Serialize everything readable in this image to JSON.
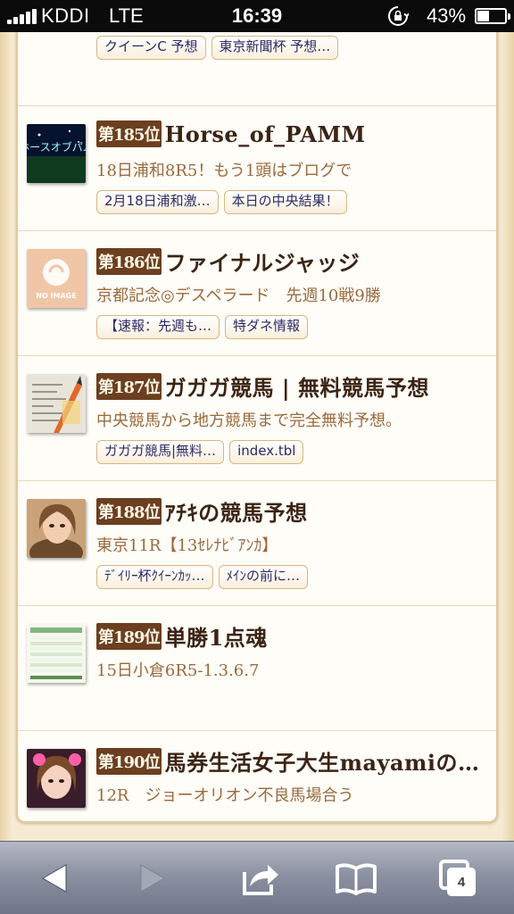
{
  "status_bar": {
    "carrier": "KDDI",
    "network": "LTE",
    "time": "16:39",
    "battery_percent": "43%",
    "battery_level": 0.43
  },
  "top_tags": [
    "クイーンC 予想",
    "東京新聞杯 予想…"
  ],
  "entries": [
    {
      "rank": "第185位",
      "title": "Horse_of_PAMM",
      "desc": "18日浦和8R5！もう1頭はブログで",
      "tags": [
        "2月18日浦和激…",
        "本日の中央結果！"
      ],
      "thumb": "night-banner-thumbnail",
      "thumb_text": "ホースオブパム"
    },
    {
      "rank": "第186位",
      "title": "ファイナルジャッジ",
      "desc": "京都記念◎デスペラード　先週10戦9勝",
      "tags": [
        "【速報：先週も…",
        "特ダネ情報"
      ],
      "thumb": "no-image-thumbnail",
      "thumb_text": "NO IMAGE"
    },
    {
      "rank": "第187位",
      "title": "ガガガ競馬 | 無料競馬予想",
      "desc": "中央競馬から地方競馬まで完全無料予想。",
      "tags": [
        "ガガガ競馬|無料…",
        "index.tbl"
      ],
      "thumb": "newspaper-pencil-thumbnail"
    },
    {
      "rank": "第188位",
      "title": "ｱﾁｷの競馬予想",
      "desc": "東京11R【13ｾﾚﾅﾋﾞｱﾝｶ】",
      "tags": [
        "ﾃﾞｲﾘｰ杯ｸｲｰﾝｶｯ…",
        "ﾒｲﾝの前に…"
      ],
      "thumb": "portrait-thumbnail"
    },
    {
      "rank": "第189位",
      "title": "単勝1点魂",
      "desc": "15日小倉6R5-1.3.6.7",
      "tags": [],
      "thumb": "table-sheet-thumbnail"
    },
    {
      "rank": "第190位",
      "title": "馬券生活女子大生mayamiの…",
      "desc": "12R　ジョーオリオン不良馬場合う",
      "tags": [],
      "thumb": "pink-portrait-thumbnail"
    }
  ],
  "toolbar": {
    "back_icon": "back-arrow-icon",
    "forward_icon": "forward-arrow-icon",
    "share_icon": "share-icon",
    "bookmarks_icon": "bookmarks-icon",
    "tabs_icon": "tabs-icon",
    "tabs_count": "4"
  },
  "colors": {
    "rank_badge": "#6b3f1f",
    "title": "#3b2414",
    "desc": "#9a6a3c",
    "tag_text": "#2b2b66",
    "tag_border": "#d9b77f"
  }
}
